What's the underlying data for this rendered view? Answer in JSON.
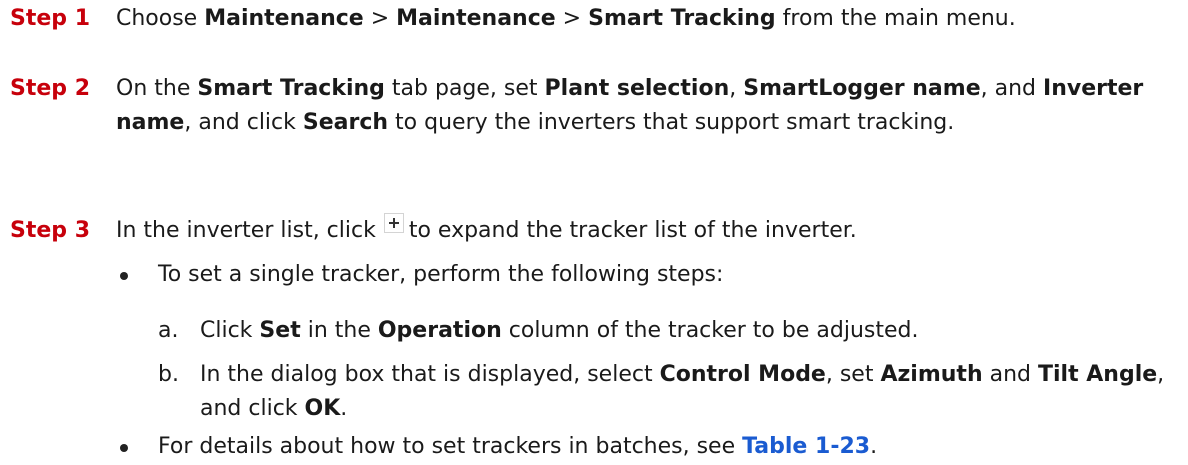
{
  "steps": [
    {
      "label": "Step 1",
      "parts": {
        "t1": "Choose ",
        "b1": "Maintenance",
        "t2": " > ",
        "b2": "Maintenance",
        "t3": " > ",
        "b3": "Smart Tracking",
        "t4": " from the main menu."
      }
    },
    {
      "label": "Step 2",
      "parts": {
        "t1": "On the ",
        "b1": "Smart Tracking",
        "t2": " tab page, set ",
        "b2": "Plant selection",
        "t3": ", ",
        "b3": "SmartLogger name",
        "t4": ", and ",
        "b4": "Inverter name",
        "t5": ", and click ",
        "b5": "Search",
        "t6": " to query the inverters that support smart tracking."
      }
    },
    {
      "label": "Step 3",
      "parts": {
        "t1": "In the inverter list, click",
        "icon": "plus-icon",
        "t2": "to expand the tracker list of the inverter."
      }
    }
  ],
  "bullets": [
    {
      "text": "To set a single tracker, perform the following steps:"
    },
    {
      "t1": "For details about how to set trackers in batches, see ",
      "link": "Table 1-23",
      "t2": "."
    }
  ],
  "substeps": [
    {
      "marker": "a.",
      "t1": "Click ",
      "b1": "Set",
      "t2": " in the ",
      "b2": "Operation",
      "t3": " column of the tracker to be adjusted."
    },
    {
      "marker": "b.",
      "t1": "In the dialog box that is displayed, select ",
      "b1": "Control Mode",
      "t2": ", set ",
      "b2": "Azimuth",
      "t3": " and ",
      "b3": "Tilt Angle",
      "t4": ", and click ",
      "b4": "OK",
      "t5": "."
    }
  ],
  "colors": {
    "step_label": "#c7000b",
    "link": "#1a5bd1",
    "text": "#1a1a1a"
  }
}
